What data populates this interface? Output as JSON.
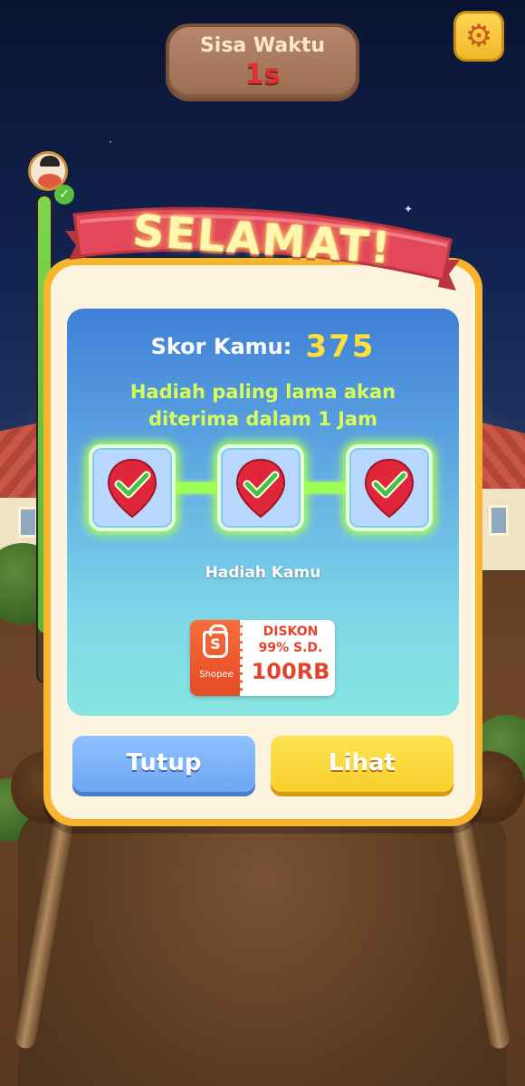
{
  "timer": {
    "label": "Sisa Waktu",
    "value": "1s"
  },
  "settings": {
    "icon": "gear-icon"
  },
  "progress": {
    "level": 0.9
  },
  "dialog": {
    "title": "SELAMAT!",
    "score_label": "Skor Kamu:",
    "score_value": "375",
    "info_line1": "Hadiah paling lama akan",
    "info_line2": "diterima dalam 1 Jam",
    "rewards": [
      {
        "icon": "map-pin-check-icon",
        "claimed": true
      },
      {
        "icon": "map-pin-check-icon",
        "claimed": true
      },
      {
        "icon": "map-pin-check-icon",
        "claimed": true
      }
    ],
    "reward_caption": "Hadiah Kamu",
    "voucher": {
      "brand": "Shopee",
      "line1": "DISKON",
      "line2": "99% S.D.",
      "line3": "100RB"
    },
    "close_label": "Tutup",
    "view_label": "Lihat"
  },
  "colors": {
    "dialog_frame": "#f6b52c",
    "panel_top": "#3f7fd6",
    "panel_bottom": "#86e6e2",
    "ribbon": "#e2485a",
    "close_button": "#7ab1f7",
    "view_button": "#f9d73a",
    "score_value": "#ffe03a",
    "info_text": "#d8ff58",
    "timer_value": "#e1302f"
  }
}
